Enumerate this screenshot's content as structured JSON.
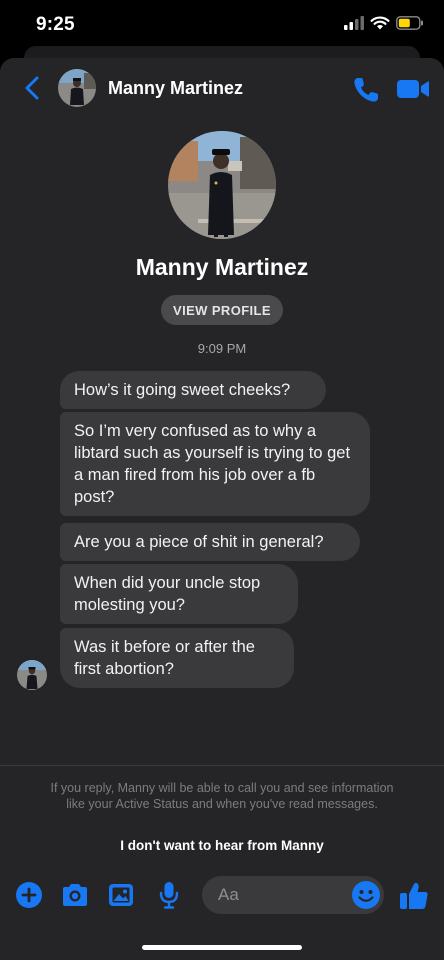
{
  "status_bar": {
    "time": "9:25"
  },
  "header": {
    "contact_name": "Manny Martinez",
    "icons": [
      "back-chevron-icon",
      "phone-icon",
      "video-camera-icon"
    ]
  },
  "profile": {
    "name": "Manny Martinez",
    "view_profile_label": "VIEW PROFILE"
  },
  "conversation": {
    "timestamp": "9:09 PM",
    "messages": [
      "How’s it going sweet cheeks?",
      "So I’m very confused as to why a libtard such as yourself is trying to get a man fired from his job over a fb post?",
      "Are you a piece of shit in general?",
      "When did your uncle stop molesting you?",
      "Was it before or after the first abortion?"
    ]
  },
  "request_notice": {
    "text": "If you reply, Manny will be able to call you and see information like your Active Status and when you've read messages.",
    "block_label": "I don't want to hear from Manny"
  },
  "composer": {
    "placeholder": "Aa",
    "icons": [
      "plus-icon",
      "camera-icon",
      "gallery-icon",
      "microphone-icon",
      "emoji-icon",
      "thumbs-up-icon"
    ]
  },
  "colors": {
    "accent": "#1877F2",
    "background": "#252527",
    "bubble": "#3a3a3c"
  }
}
